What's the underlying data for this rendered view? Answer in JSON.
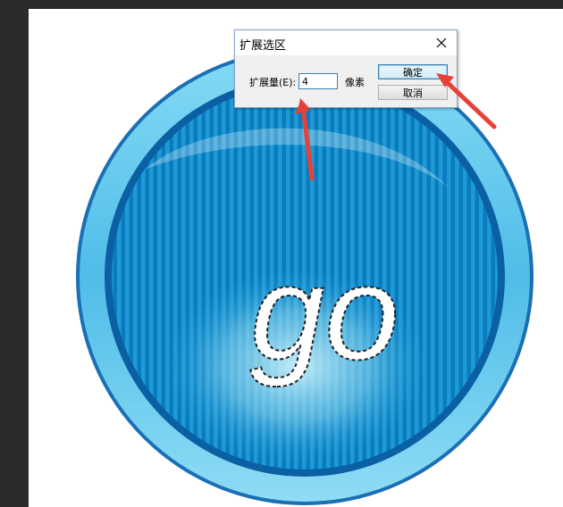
{
  "dialog": {
    "title": "扩展选区",
    "expand_label": "扩展量(E):",
    "expand_value": "4",
    "unit_label": "像素",
    "ok_label": "确定",
    "cancel_label": "取消",
    "close_icon": "close-icon"
  },
  "artwork": {
    "text": "go",
    "colors": {
      "ring_light": "#5ec8ee",
      "ring_dark": "#1a78c2",
      "stripe_light": "#1d9ad6",
      "stripe_dark": "#0a7bbd",
      "glow": "#bfeaf7"
    }
  },
  "annotations": {
    "arrow_color": "#e8413a"
  }
}
